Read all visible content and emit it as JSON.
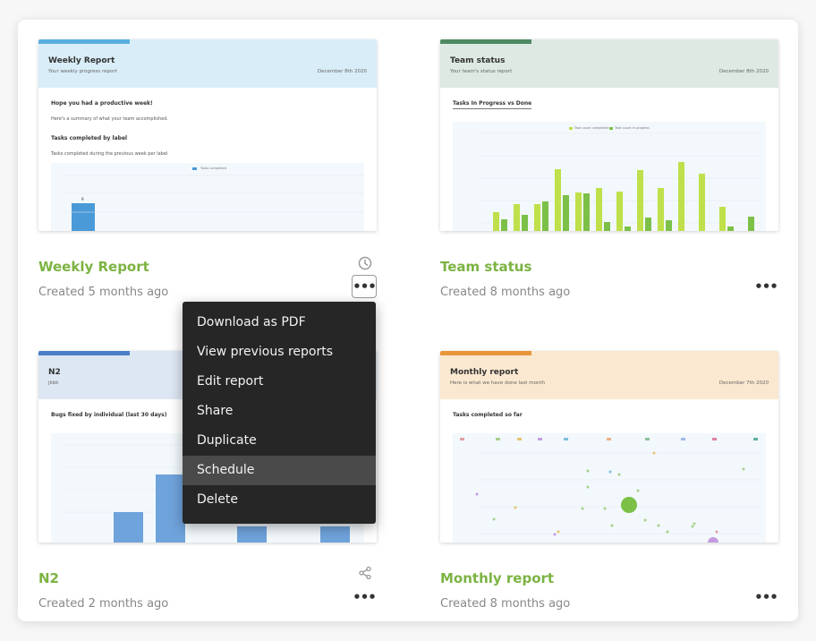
{
  "reports": [
    {
      "title": "Weekly Report",
      "created": "Created 5 months ago",
      "thumb": {
        "title": "Weekly Report",
        "subtitle": "Your weekly progress report",
        "date": "December 8th 2020",
        "greeting": "Hope you had a productive week!",
        "summary": "Here's a summary of what your team accomplished.",
        "section": "Tasks completed by label",
        "section_desc": "Tasks completed during the previous week per label",
        "chart_legend": "Tasks completed",
        "chart_bar_label": "9"
      },
      "header_color": "#d9edf8",
      "accent_color": "#5aafe0",
      "side_icon": "clock-icon"
    },
    {
      "title": "Team status",
      "created": "Created 8 months ago",
      "thumb": {
        "title": "Team status",
        "subtitle": "Your team's status report",
        "date": "December 8th 2020",
        "section": "Tasks In Progress vs Done",
        "legend_a": "Task count completed",
        "legend_b": "Task count in progress"
      },
      "header_color": "#dde9e2",
      "accent_color": "#4e8a63"
    },
    {
      "title": "N2",
      "created": "Created 2 months ago",
      "thumb": {
        "title": "N2",
        "subtitle": "jkbk",
        "section": "Bugs fixed by individual (last 30 days)"
      },
      "header_color": "#dde7f3",
      "accent_color": "#4a7fc8",
      "side_icon": "share-icon"
    },
    {
      "title": "Monthly report",
      "created": "Created 8 months ago",
      "thumb": {
        "title": "Monthly report",
        "subtitle": "Here is what we have done last month",
        "date": "December 7th 2020",
        "section": "Tasks completed so far"
      },
      "header_color": "#fbe8d0",
      "accent_color": "#e8953a"
    }
  ],
  "more_label": "•••",
  "context_menu": {
    "items": [
      "Download as PDF",
      "View previous reports",
      "Edit report",
      "Share",
      "Duplicate",
      "Schedule",
      "Delete"
    ],
    "hovered_index": 5
  }
}
